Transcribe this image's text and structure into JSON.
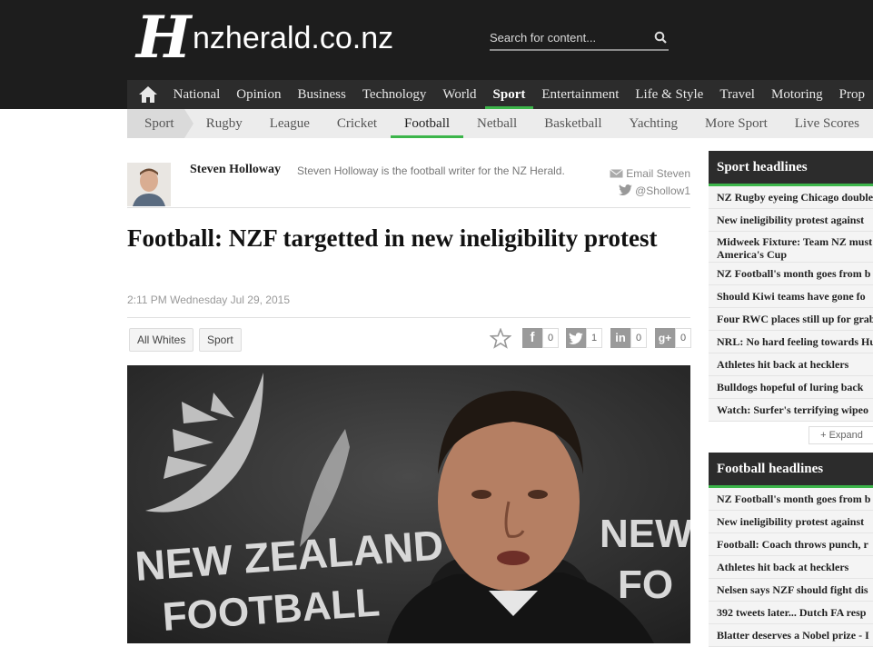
{
  "header": {
    "logo_letter": "H",
    "site_name": "nzherald.co.nz",
    "search_placeholder": "Search for content..."
  },
  "main_nav": [
    "National",
    "Opinion",
    "Business",
    "Technology",
    "World",
    "Sport",
    "Entertainment",
    "Life & Style",
    "Travel",
    "Motoring",
    "Prop"
  ],
  "main_nav_active": "Sport",
  "sub_nav": {
    "section": "Sport",
    "items": [
      "Rugby",
      "League",
      "Cricket",
      "Football",
      "Netball",
      "Basketball",
      "Yachting",
      "More Sport",
      "Live Scores"
    ],
    "active": "Football"
  },
  "author": {
    "name": "Steven Holloway",
    "bio": "Steven Holloway is the football writer for the NZ Herald.",
    "email_label": "Email Steven",
    "twitter_handle": "@Shollow1"
  },
  "article": {
    "headline": "Football: NZF targetted in new ineligibility protest",
    "dateline": "2:11 PM Wednesday Jul 29, 2015",
    "tags": [
      "All Whites",
      "Sport"
    ],
    "share": {
      "facebook": "0",
      "twitter": "1",
      "linkedin": "0",
      "googleplus": "0"
    },
    "photo_text": [
      "NEW ZEALAND",
      "FOOTBALL",
      "NEW",
      "FO"
    ]
  },
  "sidebar": {
    "sport_headlines": {
      "title": "Sport headlines",
      "items": [
        "NZ Rugby eyeing Chicago double",
        "New ineligibility protest against",
        "Midweek Fixture: Team NZ must America's Cup",
        "NZ Football's month goes from b",
        "Should Kiwi teams have gone fo",
        "Four RWC places still up for grab",
        "NRL: No hard feeling towards Hu",
        "Athletes hit back at hecklers",
        "Bulldogs hopeful of luring back",
        "Watch: Surfer's terrifying wipeo"
      ],
      "expand_label": "+ Expand"
    },
    "football_headlines": {
      "title": "Football headlines",
      "items": [
        "NZ Football's month goes from b",
        "New ineligibility protest against",
        "Football: Coach throws punch, r",
        "Athletes hit back at hecklers",
        "Nelsen says NZF should fight dis",
        "392 tweets later... Dutch FA resp",
        "Blatter deserves a Nobel prize - I"
      ]
    }
  },
  "colors": {
    "topbar": "#1d1d1d",
    "nav": "#2c2c2c",
    "accent_green": "#3cb54a",
    "subnav": "#ececec"
  }
}
